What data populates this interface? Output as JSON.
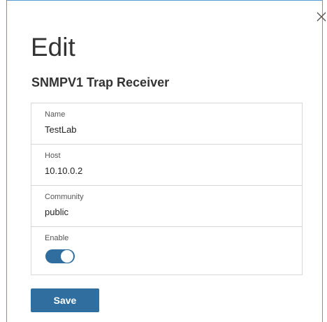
{
  "dialog": {
    "title": "Edit",
    "subtitle": "SNMPV1 Trap Receiver",
    "close_icon": "close-icon"
  },
  "fields": {
    "name": {
      "label": "Name",
      "value": "TestLab"
    },
    "host": {
      "label": "Host",
      "value": "10.10.0.2"
    },
    "community": {
      "label": "Community",
      "value": "public"
    },
    "enable": {
      "label": "Enable",
      "value": "on"
    }
  },
  "actions": {
    "save_label": "Save"
  },
  "colors": {
    "accent": "#2f6e9e",
    "dialog_border": "#5b9bd5",
    "field_border": "#d7d7d7",
    "text": "#333333"
  }
}
